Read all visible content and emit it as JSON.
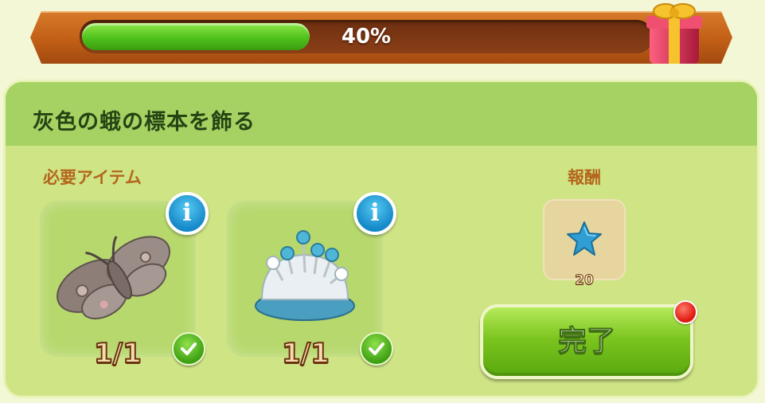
{
  "progress": {
    "value": 0.4,
    "label": "40%"
  },
  "task": {
    "title": "灰色の蛾の標本を飾る",
    "required_label": "必要アイテム",
    "reward_label": "報酬"
  },
  "items": [
    {
      "icon": "moth-icon",
      "count": "1/1"
    },
    {
      "icon": "pincushion-icon",
      "count": "1/1"
    }
  ],
  "reward": {
    "icon": "blue-star-icon",
    "amount": "20"
  },
  "complete_button": {
    "label": "完了"
  }
}
